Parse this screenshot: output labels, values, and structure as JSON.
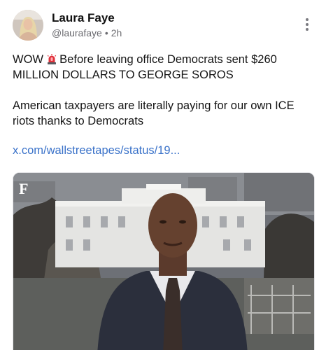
{
  "post": {
    "author_name": "Laura Faye",
    "handle": "@laurafaye",
    "separator": "•",
    "time": "2h",
    "text_line1_start": "WOW",
    "text_line1_end": "Before leaving office Democrats sent $260 MILLION DOLLARS TO GEORGE SOROS",
    "text_para2": "American taxpayers are literally paying for our own ICE riots thanks to Democrats",
    "link": "x.com/wallstreetapes/status/19...",
    "media_watermark": "F"
  },
  "icons": {
    "siren": "police-siren-icon",
    "more": "vertical-ellipsis-icon"
  },
  "colors": {
    "link": "#3a72c9",
    "meta": "#6b6b70",
    "siren_red": "#e0303a"
  }
}
